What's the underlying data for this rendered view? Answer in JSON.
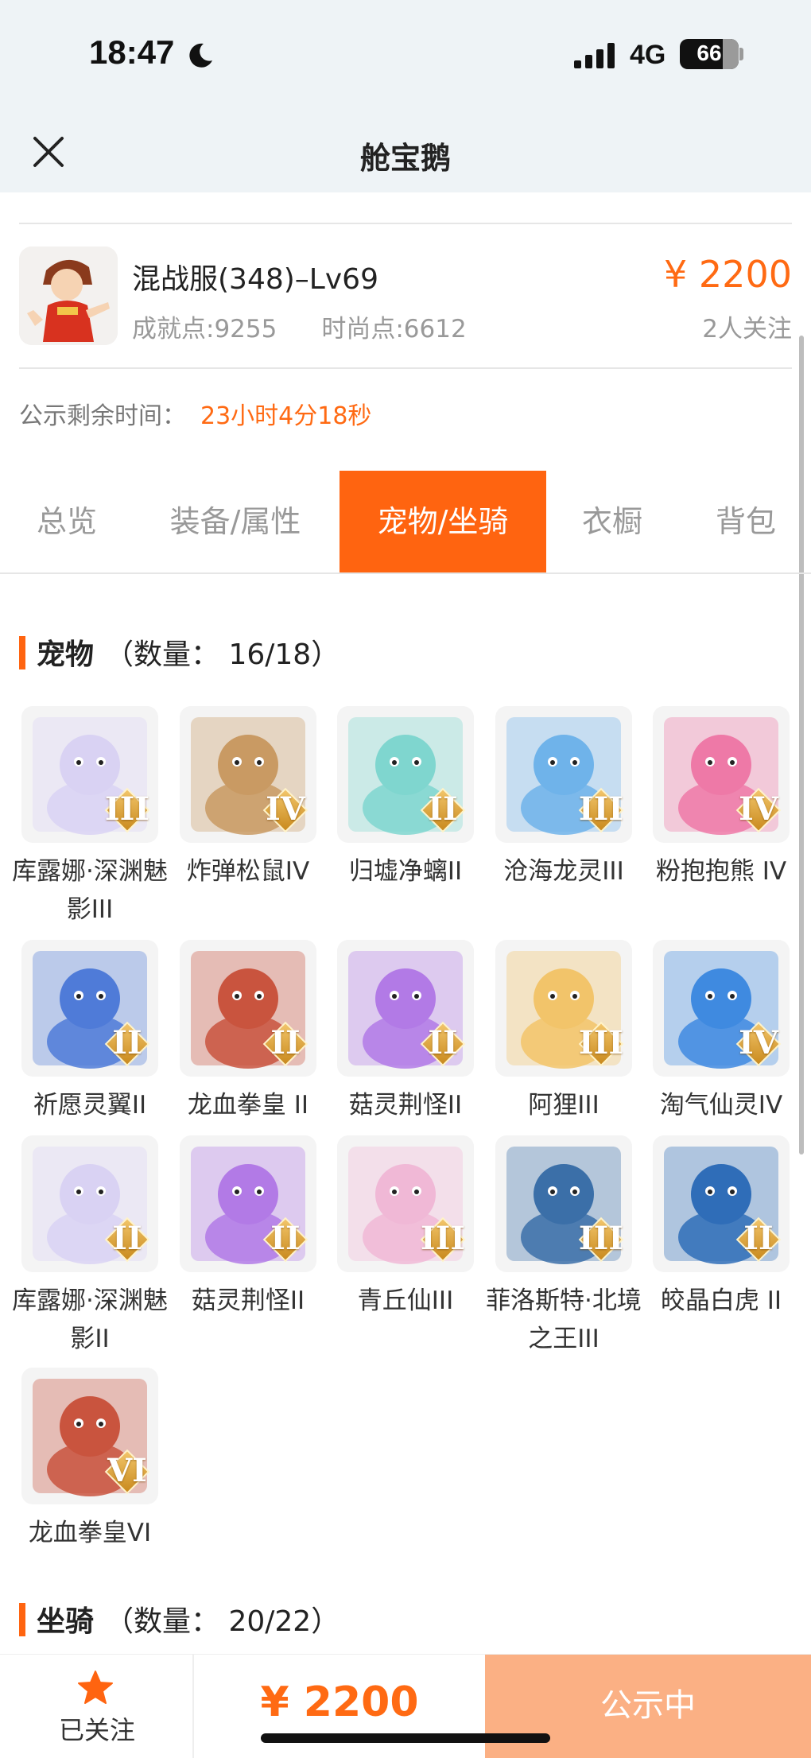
{
  "status_bar": {
    "time": "18:47",
    "network": "4G",
    "battery": "66"
  },
  "nav": {
    "title": "舱宝鹅"
  },
  "item": {
    "name": "混战服(348)–Lv69",
    "achievement": "成就点:9255",
    "fashion": "时尚点:6612",
    "price": "¥ 2200",
    "watchers": "2人关注"
  },
  "notice": {
    "label": "公示剩余时间：",
    "value": "23小时4分18秒"
  },
  "tabs": [
    {
      "label": "总览"
    },
    {
      "label": "装备/属性"
    },
    {
      "label": "宠物/坐骑"
    },
    {
      "label": "衣橱"
    },
    {
      "label": "背包"
    }
  ],
  "active_tab": "宠物/坐骑",
  "pets_section": {
    "title": "宠物",
    "count": "（数量： 16/18）"
  },
  "pets": [
    {
      "name": "库露娜·深渊魅影III",
      "tier": "III",
      "color": "#d9d2f3"
    },
    {
      "name": "炸弹松鼠IV",
      "tier": "IV",
      "color": "#c99a63"
    },
    {
      "name": "归墟净螭II",
      "tier": "II",
      "color": "#7fd6cf"
    },
    {
      "name": "沧海龙灵III",
      "tier": "III",
      "color": "#6fb3ea"
    },
    {
      "name": "粉抱抱熊 IV",
      "tier": "IV",
      "color": "#ee79a7"
    },
    {
      "name": "祈愿灵翼II",
      "tier": "II",
      "color": "#4f7bd8"
    },
    {
      "name": "龙血拳皇 II",
      "tier": "II",
      "color": "#c9543e"
    },
    {
      "name": "菇灵荆怪II",
      "tier": "II",
      "color": "#b27ae6"
    },
    {
      "name": "阿狸III",
      "tier": "III",
      "color": "#f2c46a"
    },
    {
      "name": "淘气仙灵IV",
      "tier": "IV",
      "color": "#3f8ae0"
    },
    {
      "name": "库露娜·深渊魅影II",
      "tier": "II",
      "color": "#d9d2f3"
    },
    {
      "name": "菇灵荆怪II",
      "tier": "II",
      "color": "#b27ae6"
    },
    {
      "name": "青丘仙III",
      "tier": "III",
      "color": "#f0b8d6"
    },
    {
      "name": "菲洛斯特·北境之王III",
      "tier": "III",
      "color": "#3b6fa8"
    },
    {
      "name": "皎晶白虎 II",
      "tier": "II",
      "color": "#2f6db8"
    },
    {
      "name": "龙血拳皇VI",
      "tier": "VI",
      "color": "#c9543e"
    }
  ],
  "mounts_section": {
    "title": "坐骑",
    "count": "（数量： 20/22）"
  },
  "bottom": {
    "follow_label": "已关注",
    "price": "¥ 2200",
    "status": "公示中"
  },
  "colors": {
    "accent": "#ff6410",
    "price": "#ff6a13",
    "status_button": "#fbb084"
  }
}
